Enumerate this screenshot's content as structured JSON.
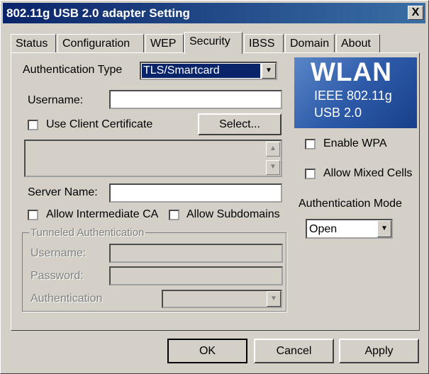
{
  "window": {
    "title": "802.11g USB 2.0 adapter Setting",
    "close_label": "X"
  },
  "tabs": [
    {
      "label": "Status"
    },
    {
      "label": "Configuration"
    },
    {
      "label": "WEP"
    },
    {
      "label": "Security"
    },
    {
      "label": "IBSS"
    },
    {
      "label": "Domain"
    },
    {
      "label": "About"
    }
  ],
  "security": {
    "auth_type_label": "Authentication Type",
    "auth_type_value": "TLS/Smartcard",
    "username_label": "Username:",
    "username_value": "",
    "use_client_cert_label": "Use Client Certificate",
    "select_button": "Select...",
    "server_name_label": "Server Name:",
    "server_name_value": "",
    "allow_intermediate_ca_label": "Allow Intermediate CA",
    "allow_subdomains_label": "Allow Subdomains",
    "tunneled": {
      "group_label": "Tunneled Authentication",
      "username_label": "Username:",
      "password_label": "Password:",
      "authentication_label": "Authentication"
    }
  },
  "logo": {
    "line1": "WLAN",
    "line2": "IEEE 802.11g",
    "line3": "USB 2.0"
  },
  "right": {
    "enable_wpa_label": "Enable WPA",
    "allow_mixed_cells_label": "Allow Mixed Cells",
    "auth_mode_label": "Authentication Mode",
    "auth_mode_value": "Open"
  },
  "buttons": {
    "ok": "OK",
    "cancel": "Cancel",
    "apply": "Apply"
  },
  "icons": {
    "dropdown": "chevron-down-icon",
    "scroll_up": "arrow-up-icon",
    "scroll_down": "arrow-down-icon"
  }
}
